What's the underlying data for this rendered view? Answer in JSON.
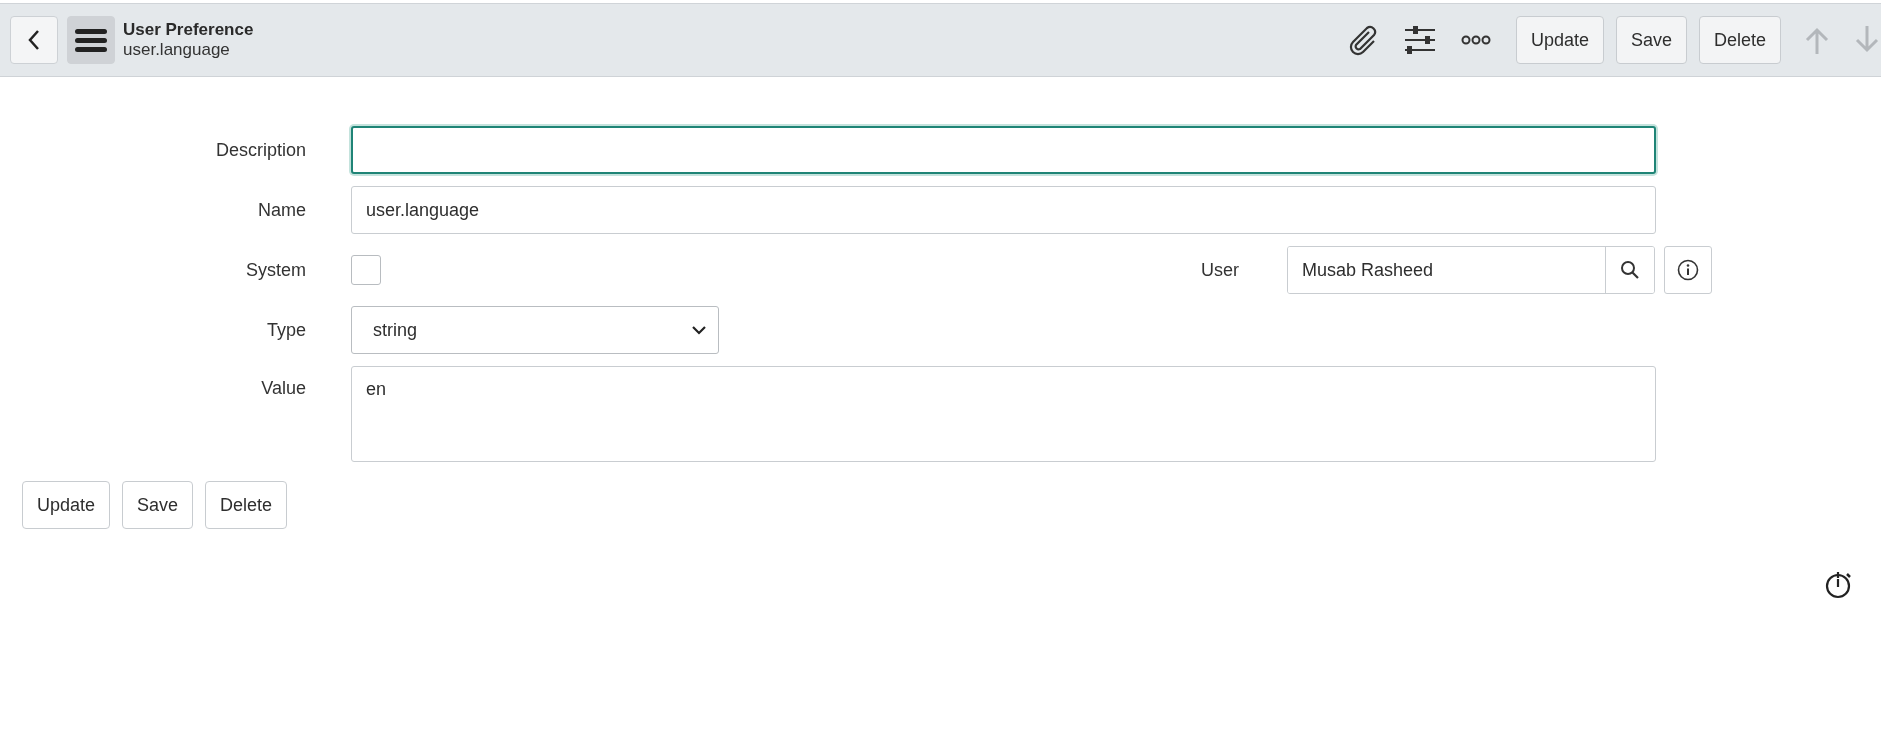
{
  "header": {
    "title": "User Preference",
    "subtitle": "user.language",
    "buttons": [
      "Update",
      "Save",
      "Delete"
    ],
    "nav_arrows": [
      {
        "kind": "up",
        "disabled": true
      },
      {
        "kind": "down",
        "disabled": true
      }
    ]
  },
  "form": {
    "description": {
      "label": "Description",
      "focused": true
    },
    "name": {
      "label": "Name",
      "value": "user.language"
    },
    "system": {
      "label": "System",
      "checked": false
    },
    "user": {
      "label": "User",
      "value": "Musab Rasheed"
    },
    "type": {
      "label": "Type",
      "value": "string"
    },
    "value": {
      "label": "Value",
      "value": "en"
    }
  },
  "footer_buttons": [
    "Update",
    "Save",
    "Delete"
  ]
}
